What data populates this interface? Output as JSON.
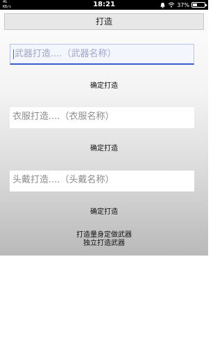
{
  "status_bar": {
    "network_line1": "4G",
    "network_line2": "KB/s",
    "time": "18:21",
    "battery": "37%",
    "battery_level": 0.37
  },
  "title": "打造",
  "weapon": {
    "placeholder": "武器打造....（武器名称）",
    "confirm_label": "确定打造"
  },
  "clothing": {
    "placeholder": "衣服打造....（衣服名称）",
    "confirm_label": "确定打造"
  },
  "headwear": {
    "placeholder": "头戴打造....（头戴名称）",
    "confirm_label": "确定打造"
  },
  "footer": {
    "line1": "打造量身定做武器",
    "line2": "独立打造武器"
  }
}
